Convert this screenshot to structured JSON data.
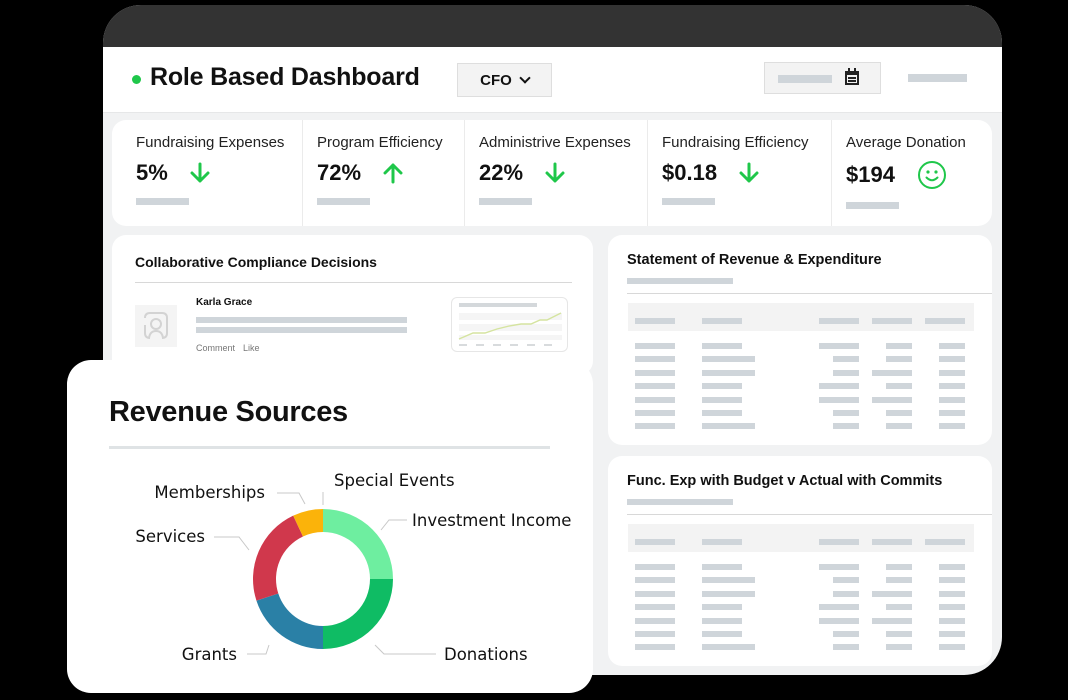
{
  "header": {
    "title": "Role Based Dashboard",
    "role_selected": "CFO",
    "status_color": "#1fc74a"
  },
  "kpis": [
    {
      "label": "Fundraising Expenses",
      "value": "5%",
      "trend": "down",
      "icon": "arrow-down-icon"
    },
    {
      "label": "Program Efficiency",
      "value": "72%",
      "trend": "up",
      "icon": "arrow-up-icon"
    },
    {
      "label": "Administrive Expenses",
      "value": "22%",
      "trend": "down",
      "icon": "arrow-down-icon"
    },
    {
      "label": "Fundraising Efficiency",
      "value": "$0.18",
      "trend": "down",
      "icon": "arrow-down-icon"
    },
    {
      "label": "Average Donation",
      "value": "$194",
      "trend": "positive",
      "icon": "smiley-icon"
    }
  ],
  "accent_green": "#1fc74a",
  "compliance": {
    "title": "Collaborative Compliance Decisions",
    "comment": {
      "author": "Karla Grace",
      "actions": [
        "Comment",
        "Like"
      ]
    }
  },
  "statement": {
    "title": "Statement of Revenue & Expenditure"
  },
  "func_exp": {
    "title": "Func. Exp with Budget v Actual with Commits"
  },
  "chart_data": {
    "type": "pie",
    "title": "Revenue Sources",
    "donut": true,
    "legend": "leader-line labels around ring",
    "slices": [
      {
        "label": "Investment Income",
        "value": 25,
        "color": "#6eeea0"
      },
      {
        "label": "Donations",
        "value": 25,
        "color": "#0fbc64"
      },
      {
        "label": "Grants",
        "value": 20,
        "color": "#2a80a6"
      },
      {
        "label": "Services",
        "value": 23,
        "color": "#d0384c"
      },
      {
        "label": "Memberships",
        "value": 7,
        "color": "#fbb30a"
      },
      {
        "label": "Special Events",
        "value": 0,
        "color": "#fbb30a"
      }
    ]
  }
}
